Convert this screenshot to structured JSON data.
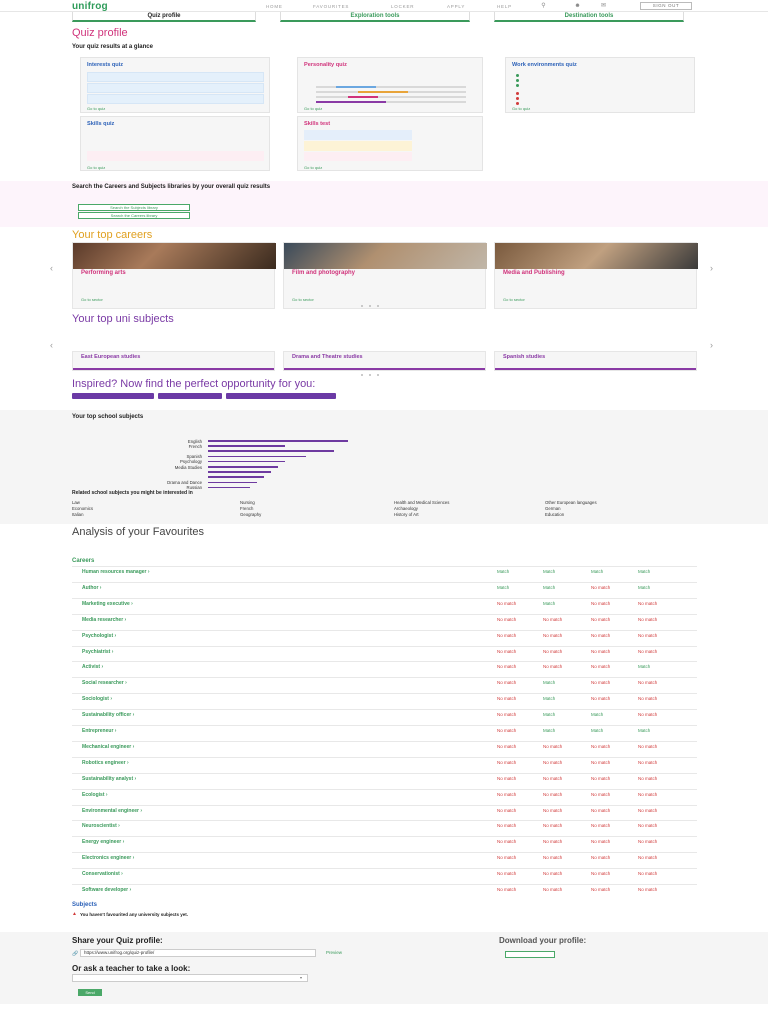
{
  "nav": {
    "logo": "unifrog",
    "links": [
      "HOME",
      "FAVOURITES",
      "LOCKER",
      "APPLY",
      "HELP"
    ],
    "sign_out": "SIGN OUT"
  },
  "tabs": [
    {
      "title": "Quiz profile",
      "sub": ""
    },
    {
      "title": "Exploration tools",
      "sub": ""
    },
    {
      "title": "Destination tools",
      "sub": ""
    }
  ],
  "quiz": {
    "title": "Quiz profile",
    "subtitle": "",
    "results_heading": "Your quiz results at a glance",
    "results_text": "",
    "interests": {
      "title": "Interests quiz",
      "sub": "",
      "link": "Go to quiz"
    },
    "personality": {
      "title": "Personality quiz",
      "sub": "",
      "link": "Go to quiz"
    },
    "work": {
      "title": "Work environments quiz",
      "sub": "",
      "link": "Go to quiz"
    },
    "skills": {
      "title": "Skills quiz",
      "sub": "",
      "link": "Go to quiz"
    },
    "skills_test": {
      "title": "Skills test",
      "sub": "",
      "link": "Go to quiz"
    }
  },
  "search": {
    "heading": "Search the Careers and Subjects libraries by your overall quiz results",
    "text": "",
    "btn_subjects": "Search the Subjects library",
    "btn_careers": "Search the Careers library"
  },
  "careers": {
    "title": "Your top careers",
    "subtitle": "",
    "cards": [
      {
        "name": "Performing arts"
      },
      {
        "name": "Film and photography"
      },
      {
        "name": "Media and Publishing"
      }
    ],
    "go_to_sector": "Go to sector"
  },
  "unis": {
    "title": "Your top uni subjects",
    "subtitle": "",
    "cards": [
      {
        "name": "East European studies"
      },
      {
        "name": "Drama and Theatre studies"
      },
      {
        "name": "Spanish studies"
      }
    ]
  },
  "inspired": {
    "title": "Inspired? Now find the perfect opportunity for you:",
    "subtitle": "",
    "pills": [
      "",
      "",
      ""
    ],
    "see_all": ""
  },
  "school": {
    "heading": "Your top school subjects",
    "text": "",
    "subjects": [
      "English",
      "French",
      "",
      "Spanish",
      "Psychology",
      "Media Studies",
      "",
      "",
      "Drama and Dance",
      "Russian"
    ],
    "values": [
      1.0,
      0.55,
      0.9,
      0.7,
      0.55,
      0.5,
      0.45,
      0.4,
      0.35,
      0.3
    ],
    "related_heading": "Related school subjects you might be interested in",
    "related": [
      [
        "Law",
        "Nursing",
        "Health and Medical Sciences",
        "Other European languages"
      ],
      [
        "Economics",
        "French",
        "Archaeology",
        "German"
      ],
      [
        "Italian",
        "Geography",
        "History of Art",
        "Education"
      ]
    ]
  },
  "favourites": {
    "title": "Analysis of your Favourites",
    "link": "",
    "subtitle": "",
    "text": "",
    "careers_label": "Careers",
    "col_heads": [
      "",
      "",
      "",
      ""
    ],
    "rows": [
      {
        "name": "Human resources manager",
        "sector": "",
        "desc": "",
        "m": [
          "Match",
          "Match",
          "Match",
          "Match"
        ]
      },
      {
        "name": "Author",
        "sector": "",
        "desc": "",
        "m": [
          "Match",
          "Match",
          "No match",
          "Match"
        ]
      },
      {
        "name": "Marketing executive",
        "sector": "",
        "desc": "",
        "m": [
          "No match",
          "Match",
          "No match",
          "No match"
        ]
      },
      {
        "name": "Media researcher",
        "sector": "",
        "desc": "",
        "m": [
          "No match",
          "No match",
          "No match",
          "No match"
        ]
      },
      {
        "name": "Psychologist",
        "sector": "",
        "desc": "",
        "m": [
          "No match",
          "No match",
          "No match",
          "No match"
        ]
      },
      {
        "name": "Psychiatrist",
        "sector": "",
        "desc": "",
        "m": [
          "No match",
          "No match",
          "No match",
          "No match"
        ]
      },
      {
        "name": "Activist",
        "sector": "",
        "desc": "",
        "m": [
          "No match",
          "No match",
          "No match",
          "Match"
        ]
      },
      {
        "name": "Social researcher",
        "sector": "",
        "desc": "",
        "m": [
          "No match",
          "Match",
          "No match",
          "No match"
        ]
      },
      {
        "name": "Sociologist",
        "sector": "",
        "desc": "",
        "m": [
          "No match",
          "Match",
          "No match",
          "No match"
        ]
      },
      {
        "name": "Sustainability officer",
        "sector": "",
        "desc": "",
        "m": [
          "No match",
          "Match",
          "Match",
          "No match"
        ]
      },
      {
        "name": "Entrepreneur",
        "sector": "",
        "desc": "",
        "m": [
          "No match",
          "Match",
          "Match",
          "Match"
        ]
      },
      {
        "name": "Mechanical engineer",
        "sector": "",
        "desc": "",
        "m": [
          "No match",
          "No match",
          "No match",
          "No match"
        ]
      },
      {
        "name": "Robotics engineer",
        "sector": "",
        "desc": "",
        "m": [
          "No match",
          "No match",
          "No match",
          "No match"
        ]
      },
      {
        "name": "Sustainability analyst",
        "sector": "",
        "desc": "",
        "m": [
          "No match",
          "No match",
          "No match",
          "No match"
        ]
      },
      {
        "name": "Ecologist",
        "sector": "",
        "desc": "",
        "m": [
          "No match",
          "No match",
          "No match",
          "No match"
        ]
      },
      {
        "name": "Environmental engineer",
        "sector": "",
        "desc": "",
        "m": [
          "No match",
          "No match",
          "No match",
          "No match"
        ]
      },
      {
        "name": "Neuroscientist",
        "sector": "",
        "desc": "",
        "m": [
          "No match",
          "No match",
          "No match",
          "No match"
        ]
      },
      {
        "name": "Energy engineer",
        "sector": "",
        "desc": "",
        "m": [
          "No match",
          "No match",
          "No match",
          "No match"
        ]
      },
      {
        "name": "Electronics engineer",
        "sector": "",
        "desc": "",
        "m": [
          "No match",
          "No match",
          "No match",
          "No match"
        ]
      },
      {
        "name": "Conservationist",
        "sector": "",
        "desc": "",
        "m": [
          "No match",
          "No match",
          "No match",
          "No match"
        ]
      },
      {
        "name": "Software developer",
        "sector": "",
        "desc": "",
        "m": [
          "No match",
          "No match",
          "No match",
          "No match"
        ]
      }
    ],
    "subjects_label": "Subjects",
    "subjects_warning": "You haven't favourited any university subjects yet.",
    "subjects_warning2": ""
  },
  "share": {
    "heading": "Share your Quiz profile:",
    "text": "",
    "url": "https://www.unifrog.org/quiz-profile/",
    "preview": "Preview",
    "teacher_heading": "Or ask a teacher to take a look:",
    "teacher_value": "",
    "send": "Send",
    "download_heading": "Download your profile:",
    "download_text": "",
    "download_btn": "",
    "download_link": ""
  },
  "footer": {
    "left": "",
    "right": ""
  },
  "colors": {
    "green": "#3a9a5b",
    "pink": "#d0337b",
    "purple": "#7a3aa5",
    "blue": "#2d62b8"
  }
}
